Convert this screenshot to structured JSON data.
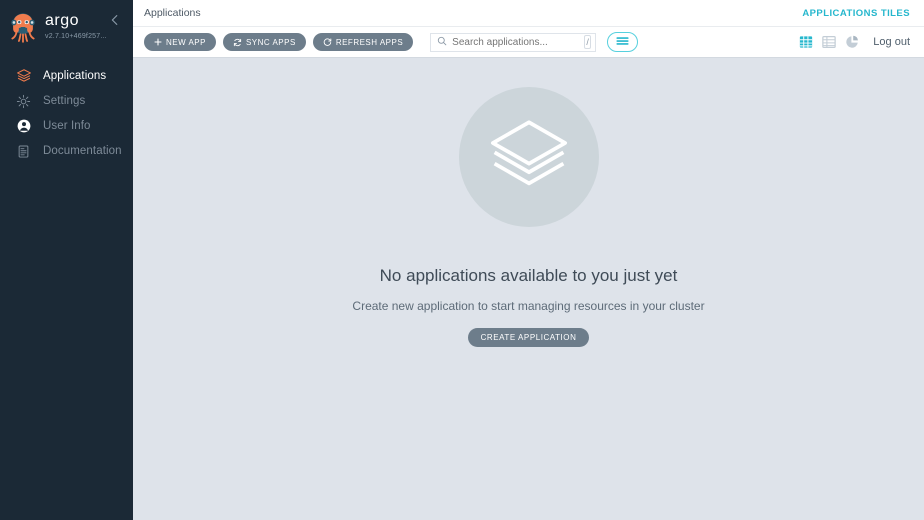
{
  "sidebar": {
    "logo_word": "argo",
    "version": "v2.7.10+469f257...",
    "collapse_icon": "arrow-left-icon",
    "items": [
      {
        "label": "Applications",
        "icon": "layers-icon",
        "active": true
      },
      {
        "label": "Settings",
        "icon": "gear-icon",
        "active": false
      },
      {
        "label": "User Info",
        "icon": "user-circle-icon",
        "active": false
      },
      {
        "label": "Documentation",
        "icon": "book-icon",
        "active": false
      }
    ]
  },
  "topbar": {
    "breadcrumb": "Applications",
    "view_label": "APPLICATIONS TILES"
  },
  "toolbar": {
    "new_app_label": "NEW APP",
    "sync_apps_label": "SYNC APPS",
    "refresh_apps_label": "REFRESH APPS",
    "search_placeholder": "Search applications...",
    "search_value": "",
    "search_shortcut": "/",
    "filter_icon": "filter-sliders-icon",
    "view_tiles_icon": "grid-tiles-icon",
    "view_list_icon": "list-view-icon",
    "view_summary_icon": "pie-chart-icon",
    "logout_label": "Log out"
  },
  "empty_state": {
    "icon": "layers-stack-icon",
    "title": "No applications available to you just yet",
    "subtitle": "Create new application to start managing resources in your cluster",
    "cta_label": "CREATE APPLICATION"
  },
  "colors": {
    "sidebar_bg": "#1b2936",
    "accent_teal": "#26b7cd",
    "button_slate": "#6d7d8b",
    "page_bg": "#dee3ea",
    "logo_orange": "#ef7b4d"
  }
}
